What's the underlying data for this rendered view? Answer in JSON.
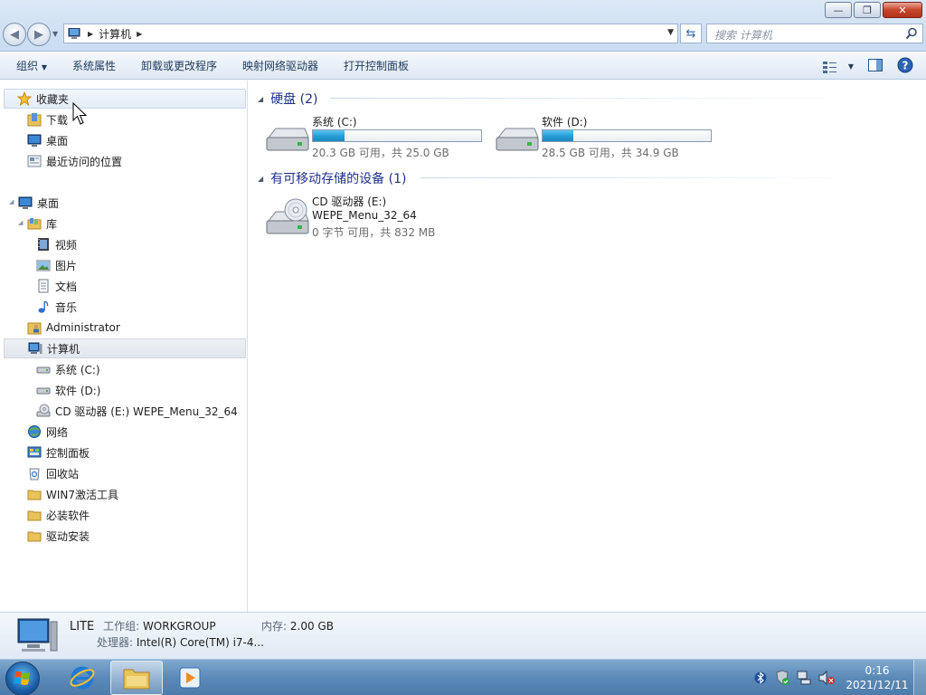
{
  "window": {
    "minimize": "—",
    "maximize": "❐",
    "close": "✕"
  },
  "address": {
    "crumb": "计算机",
    "search_placeholder": "搜索 计算机"
  },
  "toolbar": {
    "organize": "组织",
    "system_props": "系统属性",
    "uninstall": "卸载或更改程序",
    "map_drive": "映射网络驱动器",
    "control_panel": "打开控制面板"
  },
  "nav": {
    "favorites": "收藏夹",
    "downloads": "下载",
    "desktop_fav": "桌面",
    "recent": "最近访问的位置",
    "desktop": "桌面",
    "libraries": "库",
    "videos": "视频",
    "pictures": "图片",
    "documents": "文档",
    "music": "音乐",
    "administrator": "Administrator",
    "computer": "计算机",
    "drive_c": "系统 (C:)",
    "drive_d": "软件 (D:)",
    "drive_e": "CD 驱动器 (E:) WEPE_Menu_32_64",
    "network": "网络",
    "control_panel": "控制面板",
    "recycle_bin": "回收站",
    "win7_tools": "WIN7激活工具",
    "must_software": "必装软件",
    "driver_install": "驱动安装"
  },
  "content": {
    "hdd_header": "硬盘 (2)",
    "removable_header": "有可移动存储的设备 (1)",
    "drives": [
      {
        "name": "系统 (C:)",
        "free": "20.3 GB 可用，共 25.0 GB",
        "used_fraction": 0.188
      },
      {
        "name": "软件 (D:)",
        "free": "28.5 GB 可用，共 34.9 GB",
        "used_fraction": 0.183
      }
    ],
    "cd": {
      "name": "CD 驱动器 (E:)",
      "label": "WEPE_Menu_32_64",
      "free": "0 字节 可用，共 832 MB"
    }
  },
  "details": {
    "computer_name": "LITE",
    "workgroup_label": "工作组:",
    "workgroup": "WORKGROUP",
    "memory_label": "内存:",
    "memory": "2.00 GB",
    "cpu_label": "处理器:",
    "cpu": "Intel(R) Core(TM) i7-4..."
  },
  "taskbar": {
    "time": "0:16",
    "date": "2021/12/11"
  },
  "colors": {
    "accent": "#26a0da",
    "header_text": "#1e3287"
  }
}
